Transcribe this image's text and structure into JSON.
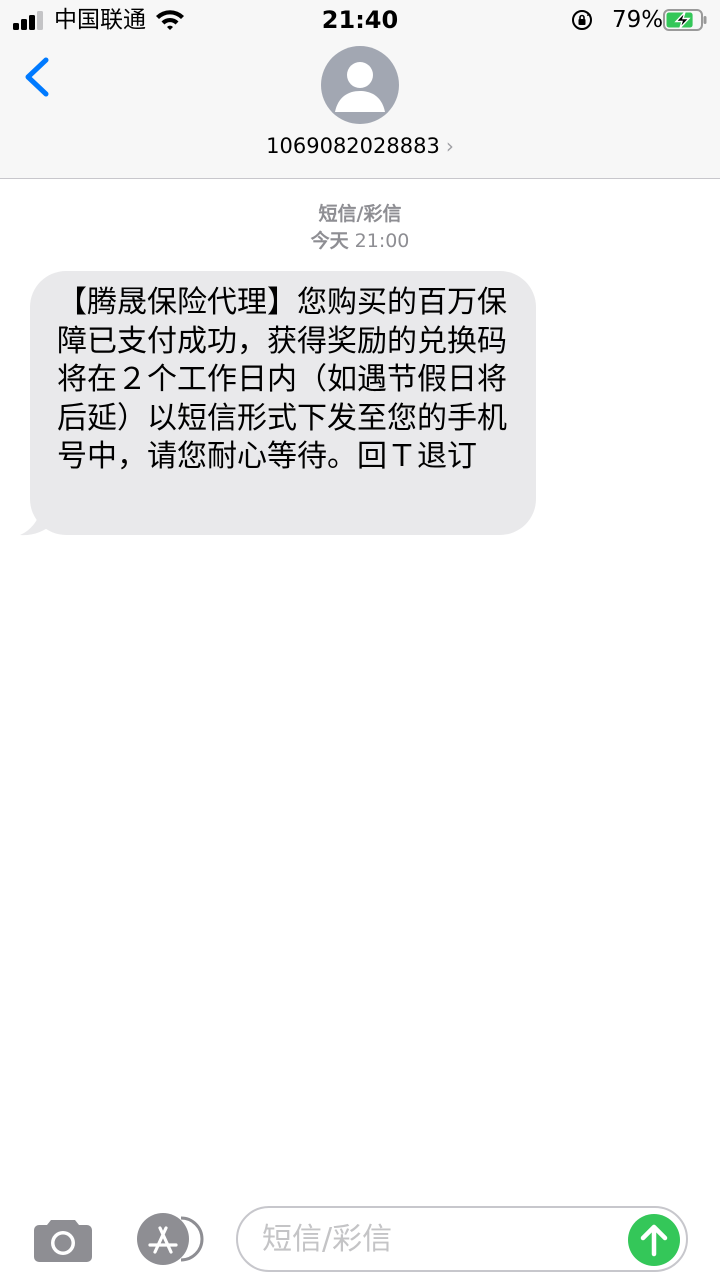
{
  "status_bar": {
    "carrier": "中国联通",
    "time": "21:40",
    "battery_percent": "79%",
    "battery_level": 0.79,
    "charging": true,
    "signal_bars": 3
  },
  "header": {
    "contact_number": "1069082028883",
    "back_icon": "chevron-left-icon",
    "avatar_icon": "person-silhouette-icon"
  },
  "thread": {
    "message_type": "短信/彩信",
    "timestamp_day": "今天",
    "timestamp_time": "21:00",
    "messages": [
      {
        "direction": "incoming",
        "text": "【腾晟保险代理】您购买的百万保障已支付成功，获得奖励的兑换码将在２个工作日内（如遇节假日将后延）以短信形式下发至您的手机号中，请您耐心等待。回Ｔ退订"
      }
    ]
  },
  "compose": {
    "placeholder": "短信/彩信",
    "camera_icon": "camera-icon",
    "apps_icon": "app-store-icon",
    "send_icon": "arrow-up-icon"
  },
  "colors": {
    "accent": "#007aff",
    "bubble_incoming": "#e9e9eb",
    "send_button": "#34c759",
    "header_bg": "#f7f7f7",
    "secondary_text": "#8e8e93"
  }
}
